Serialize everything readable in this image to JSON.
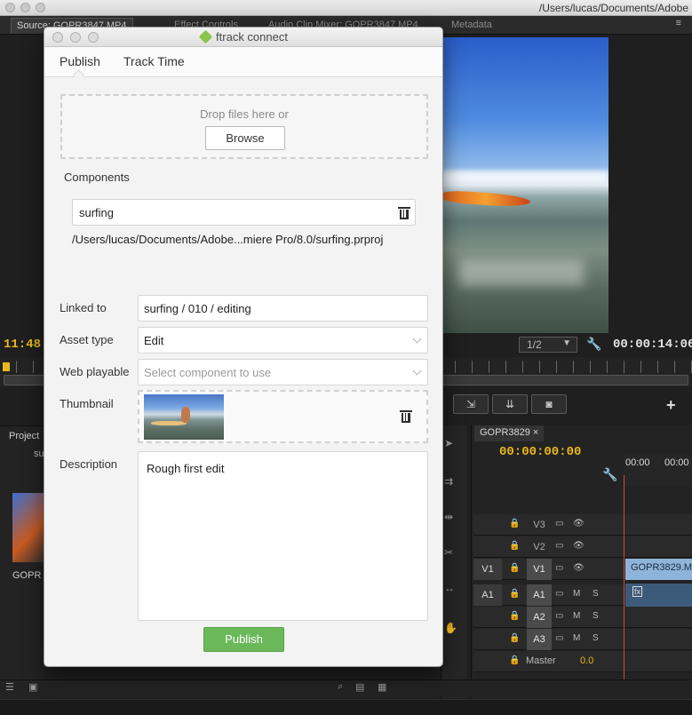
{
  "mac": {
    "path": "/Users/lucas/Documents/Adobe"
  },
  "premiere": {
    "tabs": [
      "Source: GOPR3847.MP4",
      "Effect Controls",
      "Audio Clip Mixer: GOPR3847.MP4",
      "Metadata"
    ],
    "tabs_menu_icon": "≡",
    "source_timecode_left": "11:48:",
    "zoom_level": "1/2",
    "source_duration": "00:00:14:06",
    "project_tab": "Project",
    "project_folder": "su",
    "project_clip_label": "GOPR",
    "sequence_tab": "GOPR3829 ×",
    "sequence_timecode": "00:00:00:00",
    "ruler_labels": [
      "00:00",
      "00:00"
    ],
    "tracks": [
      {
        "src": "",
        "name": "V3",
        "f1": "▭",
        "f2": "👁",
        "f3": ""
      },
      {
        "src": "",
        "name": "V2",
        "f1": "▭",
        "f2": "👁",
        "f3": ""
      },
      {
        "src": "V1",
        "name": "V1",
        "f1": "▭",
        "f2": "👁",
        "f3": ""
      },
      {
        "src": "A1",
        "name": "A1",
        "f1": "▭",
        "f2": "M",
        "f3": "S"
      },
      {
        "src": "",
        "name": "A2",
        "f1": "▭",
        "f2": "M",
        "f3": "S"
      },
      {
        "src": "",
        "name": "A3",
        "f1": "▭",
        "f2": "M",
        "f3": "S"
      }
    ],
    "master_label": "Master",
    "master_value": "0.0",
    "clip_label": "GOPR3829.M",
    "clip_fx_label": "fx",
    "icons": {
      "plus": "+",
      "wrench": "🔧",
      "lock": "🔒"
    }
  },
  "dialog": {
    "title": "ftrack connect",
    "tabs": [
      "Publish",
      "Track Time"
    ],
    "dropzone_text": "Drop files here or",
    "browse_label": "Browse",
    "components_label": "Components",
    "component_name": "surfing",
    "component_path": "/Users/lucas/Documents/Adobe...miere Pro/8.0/surfing.prproj",
    "linked_to_label": "Linked to",
    "linked_to_value": "surfing / 010 / editing",
    "asset_type_label": "Asset type",
    "asset_type_value": "Edit",
    "web_playable_label": "Web playable",
    "web_playable_placeholder": "Select component to use",
    "thumbnail_label": "Thumbnail",
    "description_label": "Description",
    "description_value": "Rough first edit",
    "publish_label": "Publish"
  }
}
